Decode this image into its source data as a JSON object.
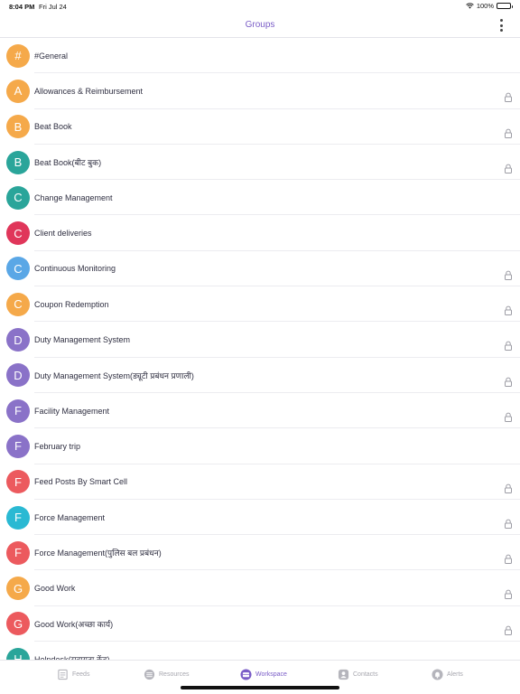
{
  "status_bar": {
    "time": "8:04 PM",
    "date": "Fri Jul 24",
    "battery": "100%"
  },
  "nav": {
    "title": "Groups"
  },
  "groups": [
    {
      "initial": "#",
      "name": "#General",
      "color": "#f5a94a",
      "locked": false
    },
    {
      "initial": "A",
      "name": "Allowances & Reimbursement",
      "color": "#f5a94a",
      "locked": true
    },
    {
      "initial": "B",
      "name": "Beat Book",
      "color": "#f5a94a",
      "locked": true
    },
    {
      "initial": "B",
      "name": "Beat Book(बीट बुक)",
      "color": "#2aa59a",
      "locked": true
    },
    {
      "initial": "C",
      "name": "Change Management",
      "color": "#2aa59a",
      "locked": false
    },
    {
      "initial": "C",
      "name": "Client deliveries",
      "color": "#e0365a",
      "locked": false
    },
    {
      "initial": "C",
      "name": "Continuous Monitoring",
      "color": "#5aa7e6",
      "locked": true
    },
    {
      "initial": "C",
      "name": "Coupon Redemption",
      "color": "#f5a94a",
      "locked": true
    },
    {
      "initial": "D",
      "name": "Duty Management System",
      "color": "#8a72c8",
      "locked": true
    },
    {
      "initial": "D",
      "name": "Duty Management System(ड्यूटी प्रबंधन प्रणाली)",
      "color": "#8a72c8",
      "locked": true
    },
    {
      "initial": "F",
      "name": "Facility Management",
      "color": "#8a72c8",
      "locked": true
    },
    {
      "initial": "F",
      "name": "February trip",
      "color": "#8a72c8",
      "locked": false
    },
    {
      "initial": "F",
      "name": "Feed Posts By Smart Cell",
      "color": "#ec5a5e",
      "locked": true
    },
    {
      "initial": "F",
      "name": "Force Management",
      "color": "#2ab9d3",
      "locked": true
    },
    {
      "initial": "F",
      "name": "Force Management(पुलिस बल प्रबंधन)",
      "color": "#ec5a5e",
      "locked": true
    },
    {
      "initial": "G",
      "name": "Good Work",
      "color": "#f5a94a",
      "locked": true
    },
    {
      "initial": "G",
      "name": "Good Work(अच्छा कार्य)",
      "color": "#ec5a5e",
      "locked": true
    },
    {
      "initial": "H",
      "name": "Helpdesk(सहायता केंद्र)",
      "color": "#2aa59a",
      "locked": true
    }
  ],
  "tabs": [
    {
      "label": "Feeds",
      "icon": "feeds-icon",
      "active": false
    },
    {
      "label": "Resources",
      "icon": "resources-icon",
      "active": false
    },
    {
      "label": "Workspace",
      "icon": "workspace-icon",
      "active": true
    },
    {
      "label": "Contacts",
      "icon": "contacts-icon",
      "active": false
    },
    {
      "label": "Alerts",
      "icon": "bell-icon",
      "active": false
    }
  ],
  "colors": {
    "accent": "#7a5dc7",
    "inactive": "#a6a6ae"
  }
}
